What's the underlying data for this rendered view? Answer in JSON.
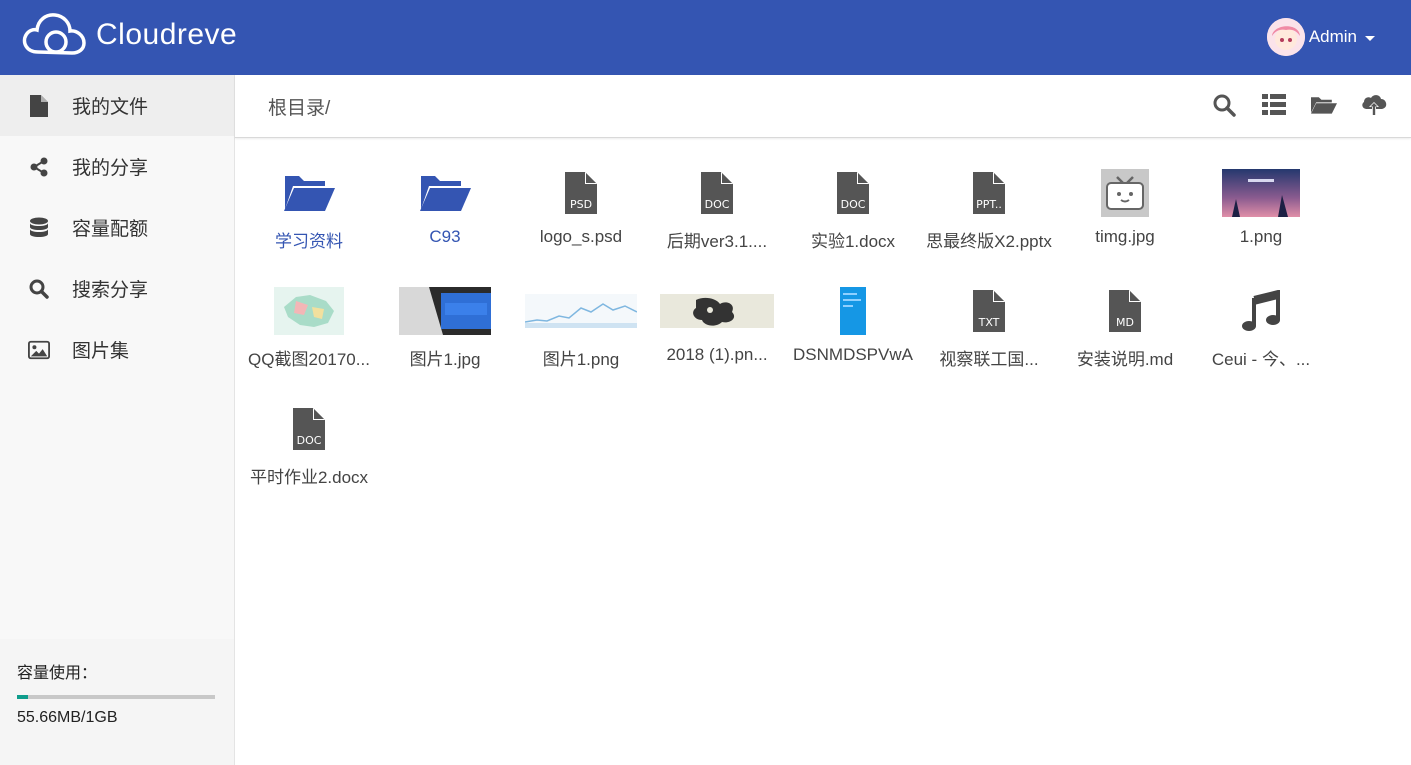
{
  "app": {
    "brand": "Cloudreve",
    "user": "Admin"
  },
  "sidebar": {
    "items": [
      {
        "label": "我的文件",
        "icon": "file-icon"
      },
      {
        "label": "我的分享",
        "icon": "share-icon"
      },
      {
        "label": "容量配额",
        "icon": "database-icon"
      },
      {
        "label": "搜索分享",
        "icon": "search-icon"
      },
      {
        "label": "图片集",
        "icon": "image-icon"
      }
    ],
    "quota": {
      "title": "容量使用：",
      "used_text": "55.66MB/1GB",
      "fraction": 0.054
    }
  },
  "header": {
    "breadcrumb": "根目录/",
    "tools": [
      "search-icon",
      "list-view-icon",
      "open-folder-icon",
      "upload-cloud-icon"
    ]
  },
  "files": [
    {
      "name": "学习资料",
      "type": "folder"
    },
    {
      "name": "C93",
      "type": "folder"
    },
    {
      "name": "logo_s.psd",
      "type": "file",
      "badge": "PSD"
    },
    {
      "name": "后期ver3.1....",
      "type": "file",
      "badge": "DOC"
    },
    {
      "name": "实验1.docx",
      "type": "file",
      "badge": "DOC"
    },
    {
      "name": "思最终版X2.pptx",
      "type": "file",
      "badge": "PPT.."
    },
    {
      "name": "timg.jpg",
      "type": "image"
    },
    {
      "name": "1.png",
      "type": "image"
    },
    {
      "name": "QQ截图20170...",
      "type": "image"
    },
    {
      "name": "图片1.jpg",
      "type": "image"
    },
    {
      "name": "图片1.png",
      "type": "image"
    },
    {
      "name": "2018 (1).pn...",
      "type": "image"
    },
    {
      "name": "DSNMDSPVwA",
      "type": "image"
    },
    {
      "name": "视察联工国...",
      "type": "file",
      "badge": "TXT"
    },
    {
      "name": "安装说明.md",
      "type": "file",
      "badge": "MD"
    },
    {
      "name": "Ceui - 今、...",
      "type": "audio"
    },
    {
      "name": "平时作业2.docx",
      "type": "file",
      "badge": "DOC"
    }
  ],
  "colors": {
    "primary": "#3455b2",
    "icon_gray": "#555555",
    "quota_fill": "#0f9d8c"
  }
}
